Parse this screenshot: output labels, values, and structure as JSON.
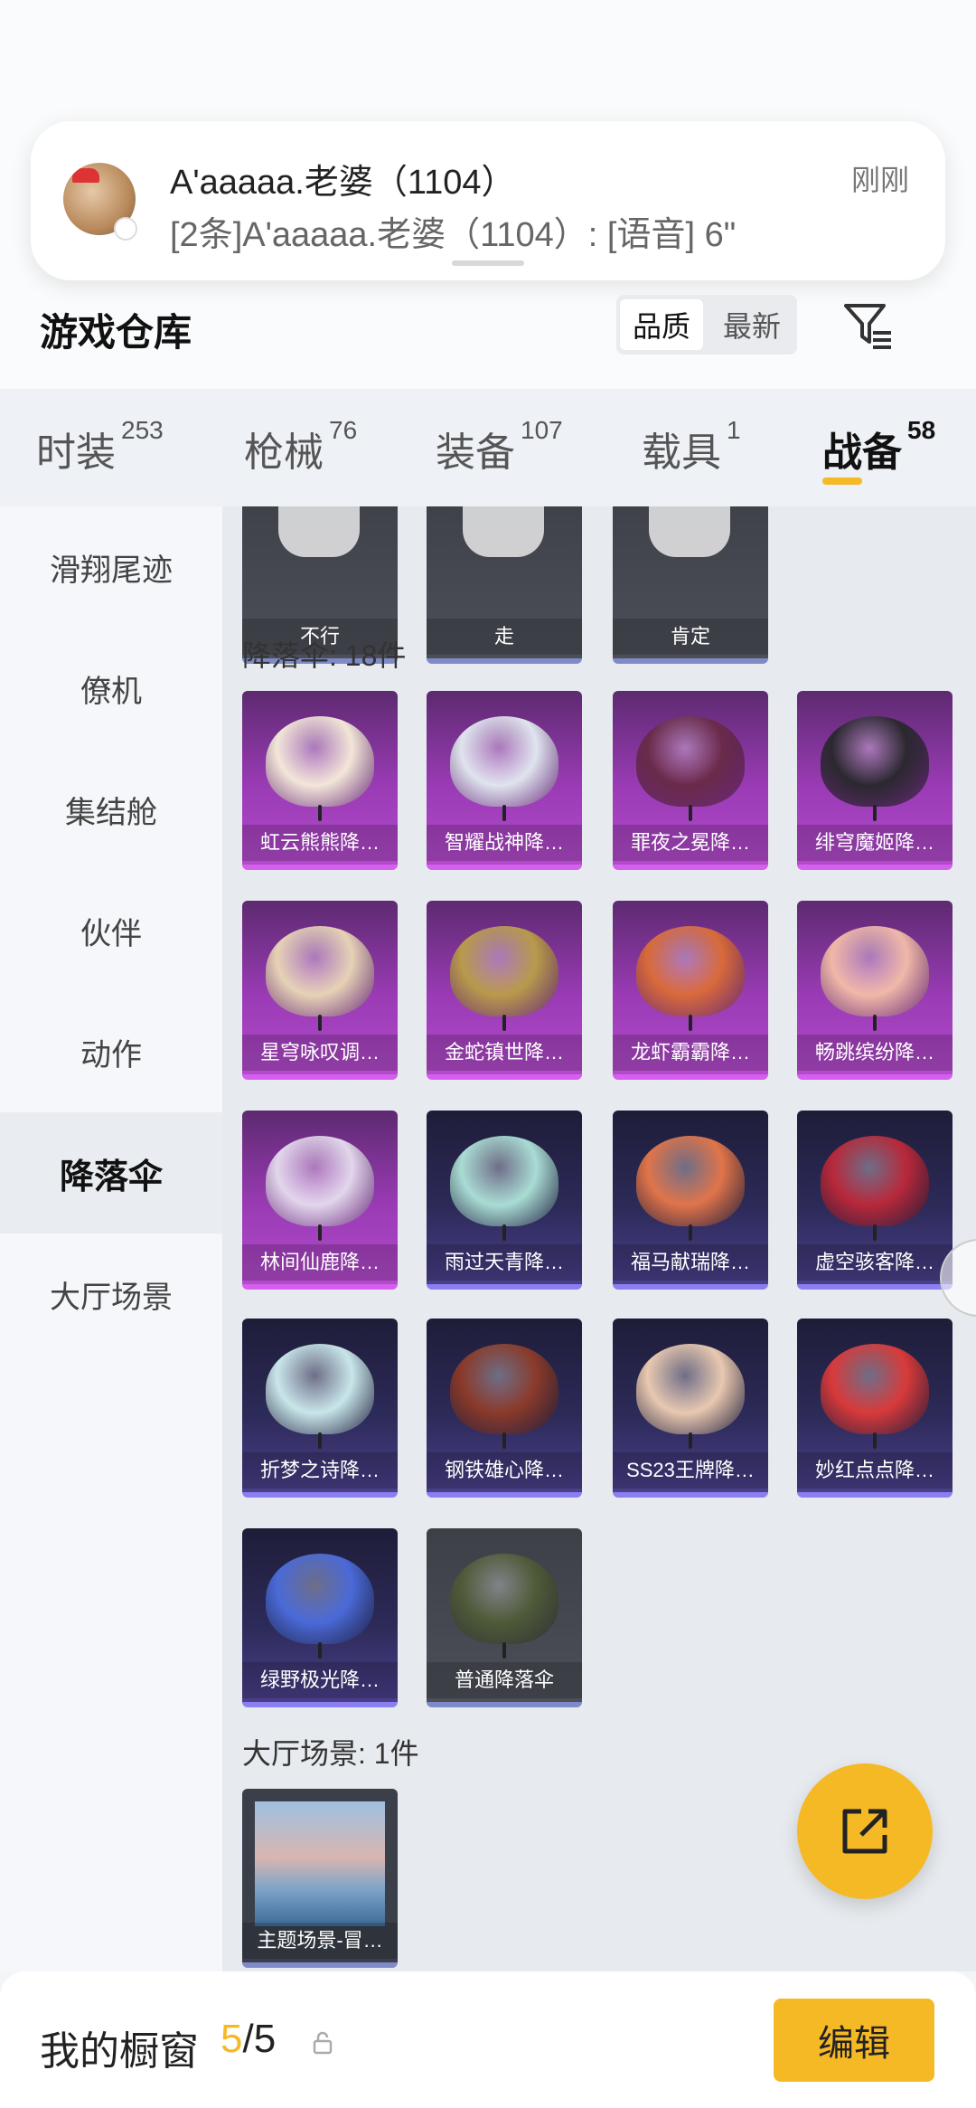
{
  "notification": {
    "title": "A'aaaaa.老婆（1104）",
    "body": "[2条]A'aaaaa.老婆（1104）: [语音] 6\"",
    "time": "刚刚"
  },
  "header": {
    "title": "游戏仓库",
    "sort_options": [
      "品质",
      "最新"
    ],
    "sort_active": "品质",
    "filter_icon": "filter-icon"
  },
  "tabs": [
    {
      "label": "时装",
      "count": "253"
    },
    {
      "label": "枪械",
      "count": "76"
    },
    {
      "label": "装备",
      "count": "107"
    },
    {
      "label": "载具",
      "count": "1"
    },
    {
      "label": "战备",
      "count": "58",
      "active": true
    }
  ],
  "side_menu": [
    {
      "label": "滑翔尾迹"
    },
    {
      "label": "僚机"
    },
    {
      "label": "集结舱"
    },
    {
      "label": "伙伴"
    },
    {
      "label": "动作"
    },
    {
      "label": "降落伞",
      "active": true
    },
    {
      "label": "大厅场景"
    }
  ],
  "emotes": [
    "不行",
    "走",
    "肯定"
  ],
  "parachutes": {
    "header": "降落伞: 18件",
    "items": [
      {
        "name": "虹云熊熊降…",
        "rarity": "purple",
        "color": "#f2e6d8"
      },
      {
        "name": "智耀战神降…",
        "rarity": "purple",
        "color": "#dfe4ee"
      },
      {
        "name": "罪夜之冕降…",
        "rarity": "purple",
        "color": "#6a2a4a"
      },
      {
        "name": "绯穹魔姬降…",
        "rarity": "purple",
        "color": "#2b2830"
      },
      {
        "name": "星穹咏叹调…",
        "rarity": "purple",
        "color": "#e6d2b6"
      },
      {
        "name": "金蛇镇世降…",
        "rarity": "purple",
        "color": "#b89a4a"
      },
      {
        "name": "龙虾霸霸降…",
        "rarity": "purple",
        "color": "#d86a3a"
      },
      {
        "name": "畅跳缤纷降…",
        "rarity": "purple",
        "color": "#f0b8a8"
      },
      {
        "name": "林间仙鹿降…",
        "rarity": "purple",
        "color": "#e2d6ec"
      },
      {
        "name": "雨过天青降…",
        "rarity": "blue",
        "color": "#a9dcd4"
      },
      {
        "name": "福马献瑞降…",
        "rarity": "blue",
        "color": "#e0744a"
      },
      {
        "name": "虚空骇客降…",
        "rarity": "blue",
        "color": "#b8283a"
      },
      {
        "name": "折梦之诗降…",
        "rarity": "blue",
        "color": "#c8e6ea"
      },
      {
        "name": "钢铁雄心降…",
        "rarity": "blue",
        "color": "#8a3a2a"
      },
      {
        "name": "SS23王牌降…",
        "rarity": "blue",
        "color": "#e8c8b0"
      },
      {
        "name": "妙红点点降…",
        "rarity": "blue",
        "color": "#d83a3a"
      },
      {
        "name": "绿野极光降…",
        "rarity": "blue",
        "color": "#4a6ad8"
      },
      {
        "name": "普通降落伞",
        "rarity": "grey",
        "color": "#4e5a38"
      }
    ]
  },
  "lobby_scenes": {
    "header": "大厅场景: 1件",
    "items": [
      {
        "name": "主题场景-冒…"
      }
    ]
  },
  "bottom_bar": {
    "label": "我的橱窗",
    "count_current": "5",
    "count_total": "/5",
    "edit_label": "编辑"
  },
  "colors": {
    "accent": "#f5b926",
    "purple_rarity": "#b24acb",
    "blue_rarity": "#4a3f8a"
  }
}
